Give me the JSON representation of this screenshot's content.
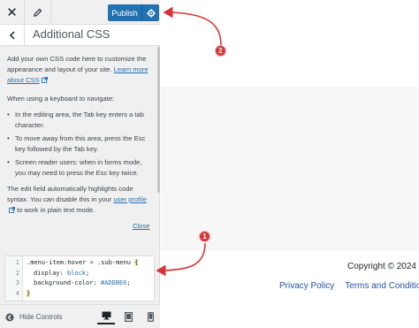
{
  "topbar": {
    "close_icon": "close-icon",
    "edit_icon": "pencil-icon",
    "publish_label": "Publish",
    "publish_settings_icon": "gear-icon",
    "accent": "#2271b1"
  },
  "panel": {
    "back_icon": "chevron-left-icon",
    "title": "Additional CSS"
  },
  "description": {
    "intro": "Add your own CSS code here to customize the appearance and layout of your site. ",
    "intro_link": "Learn more about CSS",
    "keyboard_heading": "When using a keyboard to navigate:",
    "bullets": [
      "In the editing area, the Tab key enters a tab character.",
      "To move away from this area, press the Esc key followed by the Tab key.",
      "Screen reader users: when in forms mode, you may need to press the Esc key twice."
    ],
    "highlight_text_before": "The edit field automatically highlights code syntax. You can disable this in your ",
    "highlight_link": "user profile",
    "highlight_text_after": " to work in plain text mode.",
    "close_link": "Close"
  },
  "editor": {
    "line_numbers": [
      "1",
      "2",
      "3",
      "4"
    ],
    "lines": [
      {
        "selector": ".menu-item:hover > .sub-menu ",
        "brace": "{"
      },
      {
        "property": "display: ",
        "value": "block",
        "end": ";"
      },
      {
        "property": "background-color: ",
        "value": "#ADDBE6",
        "end": ";"
      },
      {
        "brace": "}"
      }
    ]
  },
  "footer": {
    "hide_controls_icon": "hide-controls-icon",
    "hide_controls_label": "Hide Controls",
    "devices": [
      "desktop-icon",
      "tablet-icon",
      "mobile-icon"
    ]
  },
  "preview": {
    "copyright": "Copyright © 2024",
    "links": [
      "Privacy Policy",
      "Terms and Conditions"
    ]
  },
  "annotations": {
    "badge_1": "1",
    "badge_2": "2",
    "color": "#d63638"
  }
}
